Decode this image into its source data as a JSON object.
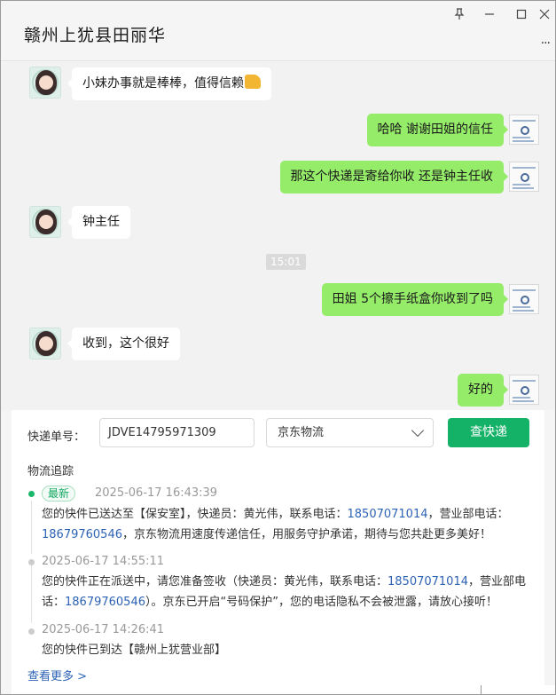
{
  "window": {
    "title": "赣州上犹县田丽华",
    "controls": {
      "pin": "⫯",
      "minimize": "—",
      "maximize": "☐",
      "close": "✕",
      "more": "..."
    }
  },
  "chat": {
    "messages": [
      {
        "side": "left",
        "text": "小妹办事就是棒棒，值得信赖",
        "emoji": "thumbs-up"
      },
      {
        "side": "right",
        "text": "哈哈 谢谢田姐的信任"
      },
      {
        "side": "right",
        "text": "那这个快递是寄给你收 还是钟主任收"
      },
      {
        "side": "left",
        "text": "钟主任"
      },
      {
        "side": "right",
        "text": "田姐 5个擦手纸盒你收到了吗"
      },
      {
        "side": "left",
        "text": "收到，这个很好"
      },
      {
        "side": "right",
        "text": "好的"
      }
    ],
    "time_divider": "15:01"
  },
  "tracking": {
    "label_no": "快递单号：",
    "tracking_no": "JDVE14795971309",
    "carrier": "京东物流",
    "query_button": "查快递",
    "section_title": "物流追踪",
    "new_tag": "最新",
    "events": [
      {
        "time": "2025-06-17 16:43:39",
        "text_a": "您的快件已送达至【保安室】，快递员：黄光伟，联系电话：",
        "phone_a": "18507071014",
        "text_b": "，营业部电话：",
        "phone_b": "18679760546",
        "text_c": "，京东物流用速度传递信任，用服务守护承诺，期待与您共赴更多美好！"
      },
      {
        "time": "2025-06-17 14:55:11",
        "text_a": "您的快件正在派送中，请您准备签收（快递员：黄光伟，联系电话：",
        "phone_a": "18507071014",
        "text_b": "，营业部电话：",
        "phone_b": "18679760546",
        "text_c": "）。京东已开启“号码保护”，您的电话隐私不会被泄露，请放心接听！"
      },
      {
        "time": "2025-06-17 14:26:41",
        "text_a": "您的快件已到达【赣州上犹营业部】"
      }
    ],
    "see_more": "查看更多 >"
  },
  "colors": {
    "bubble_right": "#95ec69",
    "bubble_left": "#ffffff",
    "primary_button": "#13b267",
    "link": "#2d63b5",
    "active_dot": "#19b86b"
  }
}
